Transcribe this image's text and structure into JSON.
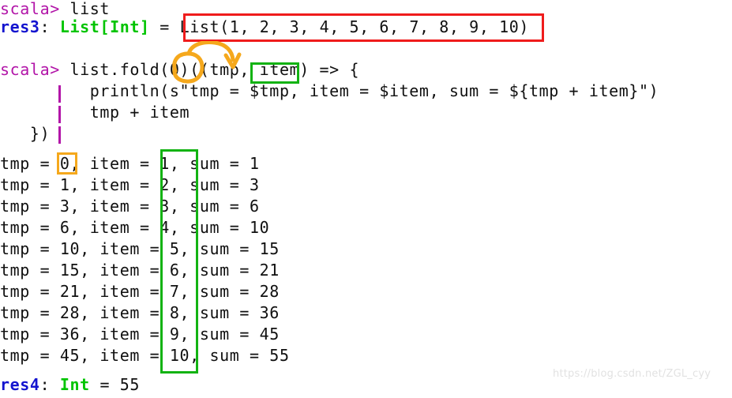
{
  "console": {
    "prompt_label": "scala> ",
    "lines": [
      {
        "id": "line-input-list",
        "prompt": "scala> ",
        "code": "list"
      },
      {
        "id": "line-res3",
        "res_name": "res3",
        "separator": ": ",
        "res_type": "List[Int]",
        "assign": " = ",
        "value": "List(1, 2, 3, 4, 5, 6, 7, 8, 9, 10)"
      },
      {
        "id": "line-input-fold",
        "prompt": "scala> ",
        "code": "list.fold(0)((tmp, item) => {"
      },
      {
        "id": "line-println",
        "code": "         println(s\"tmp = $tmp, item = $item, sum = ${tmp + item}\")"
      },
      {
        "id": "line-sum-expr",
        "code": "         tmp + item"
      },
      {
        "id": "line-close-brace",
        "code": "   })"
      }
    ],
    "output_rows": [
      "tmp = 0, item = 1, sum = 1",
      "tmp = 1, item = 2, sum = 3",
      "tmp = 3, item = 3, sum = 6",
      "tmp = 6, item = 4, sum = 10",
      "tmp = 10, item = 5, sum = 15",
      "tmp = 15, item = 6, sum = 21",
      "tmp = 21, item = 7, sum = 28",
      "tmp = 28, item = 8, sum = 36",
      "tmp = 36, item = 9, sum = 45",
      "tmp = 45, item = 10, sum = 55"
    ],
    "result_line": {
      "res_name": "res4",
      "separator": ": ",
      "res_type": "Int",
      "assign": " = ",
      "value": "55"
    }
  },
  "annotations": {
    "red_box": {
      "name": "red-highlight-list-literal",
      "target": "List(1, 2, 3, 4, 5, 6, 7, 8, 9, 10)",
      "color": "#ef1c1c"
    },
    "green_box_item_param": {
      "name": "green-highlight-item-param",
      "target": "item",
      "color": "#13b313"
    },
    "green_box_item_column": {
      "name": "green-highlight-item-column",
      "target": "item values 1..10",
      "color": "#13b313"
    },
    "orange_box_zero": {
      "name": "orange-highlight-initial-tmp",
      "target": "0",
      "color": "#f5a81c"
    },
    "orange_circle_arrow": {
      "name": "orange-circle-arrow-fold-seed",
      "target": "fold(0) seed flows into tmp",
      "color": "#f5a81c"
    }
  },
  "watermark": {
    "text": "https://blog.csdn.net/ZGL_cyy"
  }
}
